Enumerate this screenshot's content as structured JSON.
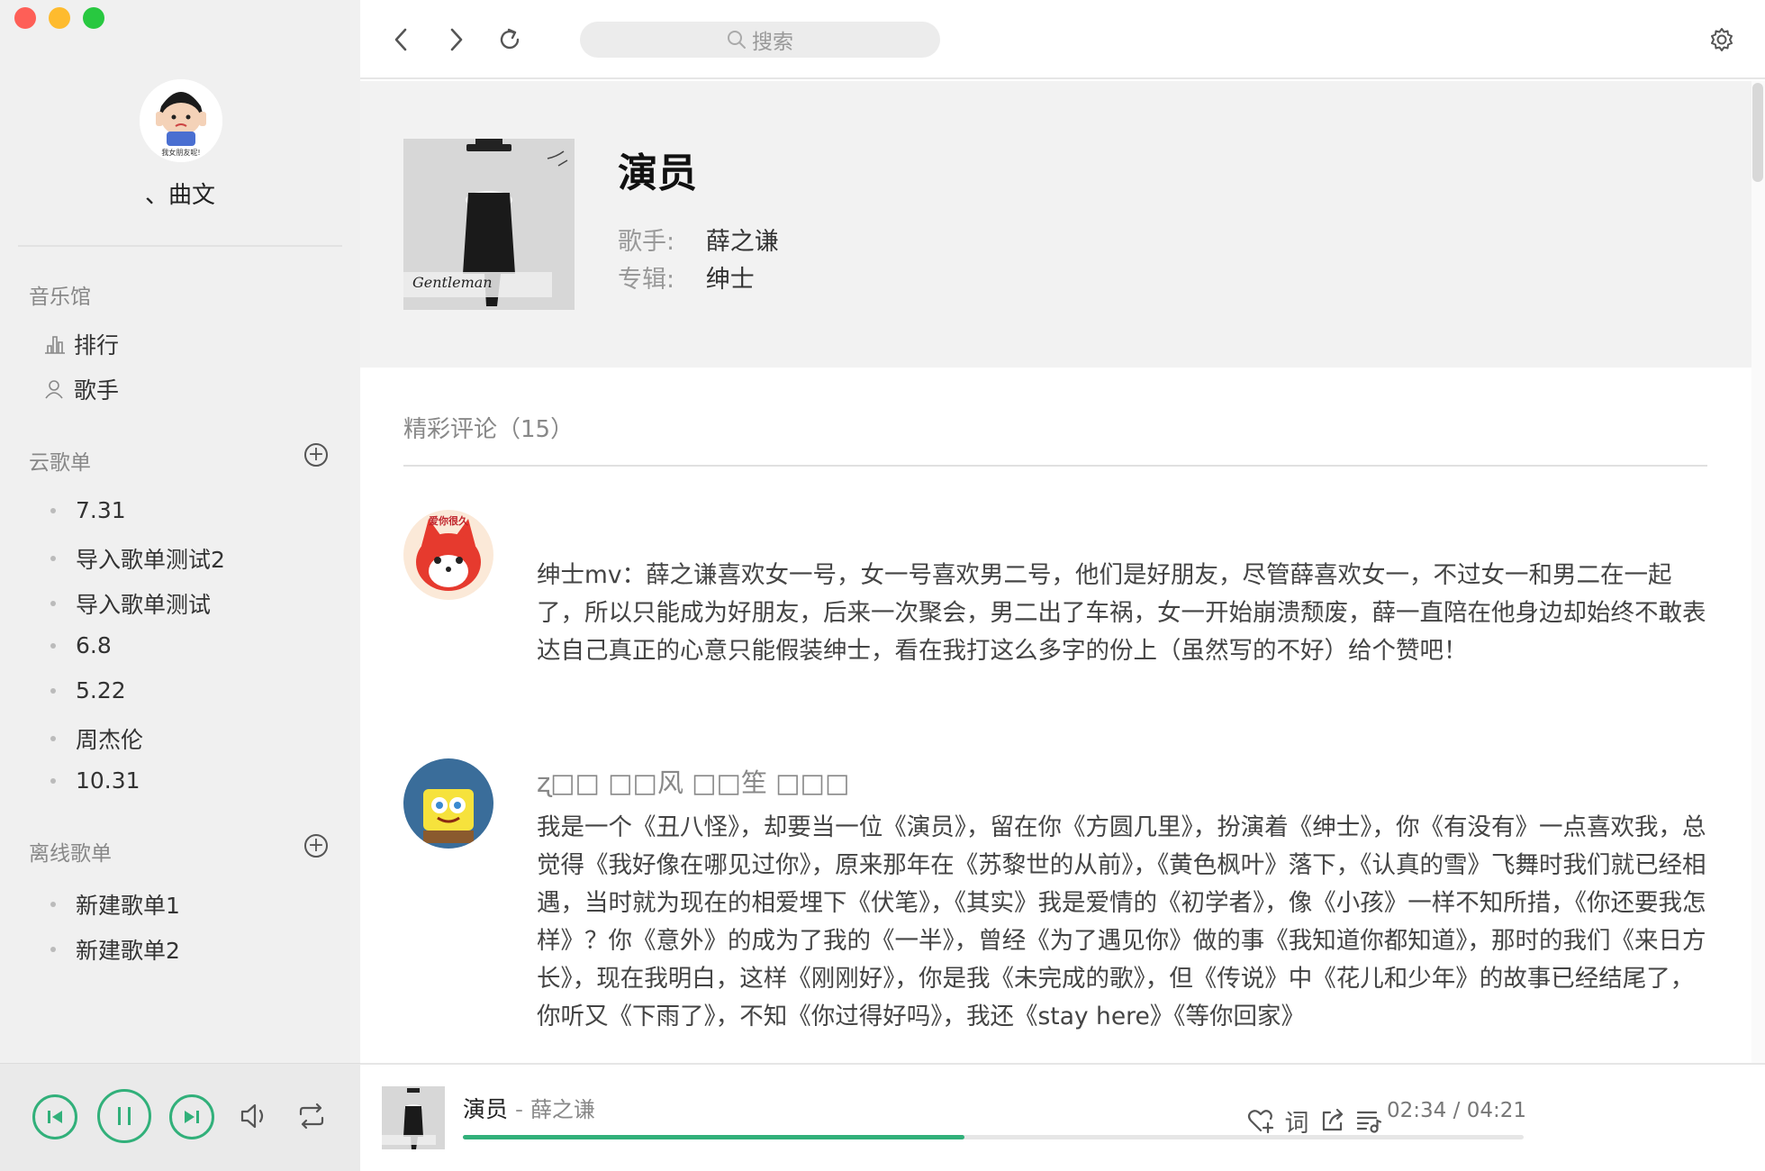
{
  "window": {
    "controls": [
      "close",
      "minimize",
      "zoom"
    ],
    "colors": {
      "close": "#fe5f57",
      "minimize": "#febb2e",
      "zoom": "#28c840"
    }
  },
  "user": {
    "name": "、曲文",
    "avatar_icon": "cartoon-avatar-icon",
    "avatar_caption": "我女朋友呢!"
  },
  "sidebar": {
    "music_hall": {
      "title": "音乐馆",
      "items": [
        {
          "label": "排行",
          "icon": "chart-bar-icon"
        },
        {
          "label": "歌手",
          "icon": "user-icon"
        }
      ]
    },
    "cloud_playlists": {
      "title": "云歌单",
      "items": [
        "7.31",
        "导入歌单测试2",
        "导入歌单测试",
        "6.8",
        "5.22",
        "周杰伦",
        "10.31"
      ]
    },
    "offline_playlists": {
      "title": "离线歌单",
      "items": [
        "新建歌单1",
        "新建歌单2"
      ]
    }
  },
  "toolbar": {
    "search_placeholder": "搜索"
  },
  "song": {
    "title": "演员",
    "artist_label": "歌手:",
    "artist": "薛之谦",
    "album_label": "专辑:",
    "album": "绅士",
    "cover_text": "Gentleman"
  },
  "comments": {
    "title": "精彩评论（15）",
    "items": [
      {
        "name": "",
        "avatar_icon": "fox-avatar-icon",
        "avatar_caption": "爱你很久",
        "text": "绅士mv：薛之谦喜欢女一号，女一号喜欢男二号，他们是好朋友，尽管薛喜欢女一，不过女一和男二在一起了，所以只能成为好朋友，后来一次聚会，男二出了车祸，女一开始崩溃颓废，薛一直陪在他身边却始终不敢表达自己真正的心意只能假装绅士，看在我打这么多字的份上（虽然写的不好）给个赞吧！"
      },
      {
        "name": "ʐ□□ □□风 □□笙 □□□",
        "avatar_icon": "spongebob-avatar-icon",
        "text": "我是一个《丑八怪》，却要当一位《演员》，留在你《方圆几里》，扮演着《绅士》，你《有没有》一点喜欢我，总觉得《我好像在哪见过你》，原来那年在《苏黎世的从前》，《黄色枫叶》落下，《认真的雪》飞舞时我们就已经相遇，当时就为现在的相爱埋下《伏笔》，《其实》我是爱情的《初学者》，像《小孩》一样不知所措，《你还要我怎样》？你《意外》的成为了我的《一半》，曾经《为了遇见你》做的事《我知道你都知道》，那时的我们《来日方长》，现在我明白，这样《刚刚好》，你是我《未完成的歌》，但《传说》中《花儿和少年》的故事已经结尾了，你听又《下雨了》，不知《你过得好吗》，我还《stay here》《等你回家》"
      }
    ]
  },
  "player": {
    "now_playing": {
      "title": "演员",
      "separator": " - ",
      "artist": "薛之谦"
    },
    "current_time": "02:34",
    "total_time": "04:21",
    "time_separator": " / ",
    "progress": 0.473,
    "lyrics_label": "词",
    "accent": "#31b07a"
  }
}
